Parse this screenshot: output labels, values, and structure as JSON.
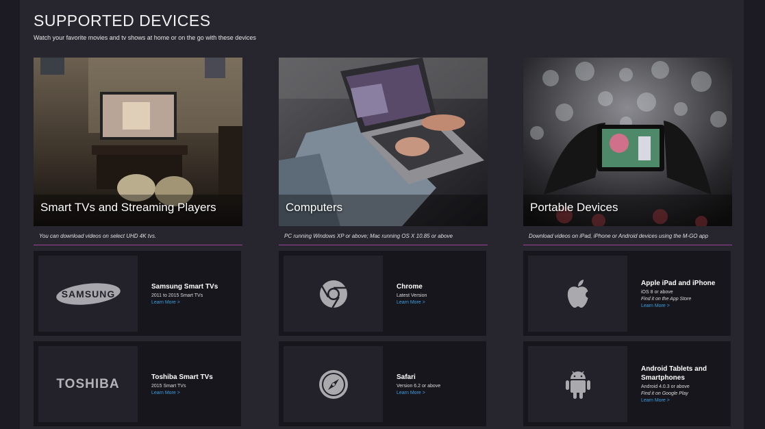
{
  "header": {
    "title": "SUPPORTED DEVICES",
    "subtitle": "Watch your favorite movies and tv shows at home or on the go with these devices"
  },
  "columns": [
    {
      "hero_label": "Smart TVs and Streaming Players",
      "description": "You can download videos on select UHD 4K tvs.",
      "devices": [
        {
          "name": "Samsung Smart TVs",
          "lines": [
            "2011 to 2015 Smart TVs"
          ],
          "italic": "",
          "more": "Learn More >",
          "logo_text": "SAMSUNG",
          "icon": "samsung-logo"
        },
        {
          "name": "Toshiba Smart TVs",
          "lines": [
            "2015 Smart TVs"
          ],
          "italic": "",
          "more": "Learn More >",
          "logo_text": "TOSHIBA",
          "icon": "toshiba-logo"
        }
      ]
    },
    {
      "hero_label": "Computers",
      "description": "PC running Windows XP or above; Mac running OS X 10.85 or above",
      "devices": [
        {
          "name": "Chrome",
          "lines": [
            "Latest Version"
          ],
          "italic": "",
          "more": "Learn More >",
          "icon": "chrome-icon"
        },
        {
          "name": "Safari",
          "lines": [
            "Version 6.2 or above"
          ],
          "italic": "",
          "more": "Learn More >",
          "icon": "compass-icon"
        }
      ]
    },
    {
      "hero_label": "Portable Devices",
      "description": "Download videos on iPad, iPhone or Android devices using the M-GO app",
      "devices": [
        {
          "name": "Apple iPad and iPhone",
          "lines": [
            "iOS 8 or above"
          ],
          "italic": "Find it on the App Store",
          "more": "Learn More >",
          "icon": "apple-icon"
        },
        {
          "name": "Android Tablets and Smartphones",
          "lines": [
            "Android 4.0.3 or above"
          ],
          "italic": "Find it on Google Play",
          "more": "Learn More >",
          "icon": "android-icon"
        }
      ]
    }
  ]
}
